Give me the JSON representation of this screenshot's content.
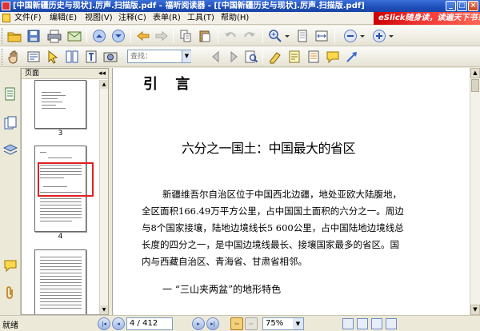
{
  "window": {
    "title": "[中国新疆历史与现状].厉声.扫描版.pdf - 福昕阅读器 - [[中国新疆历史与现状].厉声.扫描版.pdf]",
    "minimize": "_",
    "maximize": "□",
    "close": "×"
  },
  "menu": {
    "items": [
      {
        "label": "文件(F)"
      },
      {
        "label": "编辑(E)"
      },
      {
        "label": "视图(V)"
      },
      {
        "label": "注释(C)"
      },
      {
        "label": "表单(R)"
      },
      {
        "label": "工具(T)"
      },
      {
        "label": "帮助(H)"
      }
    ],
    "banner": "eSlick随身读，读遍天下书！"
  },
  "toolbar": {
    "find_placeholder": "查找：",
    "find_dropdown": "▼"
  },
  "pages_panel": {
    "title": "页面",
    "collapse": "◂◂",
    "thumbnails": [
      {
        "label": "3"
      },
      {
        "label": "4"
      }
    ]
  },
  "document": {
    "heading": "引 言",
    "subtitle": "六分之一国土：中国最大的省区",
    "paragraph_lines": [
      "新疆维吾尔自治区位于中国西北边疆，地处亚欧大陆腹地，",
      "全区面积166.49万平方公里，占中国国土面积的六分之一。周边",
      "与8个国家接壤，陆地边境线长5 600公里，占中国陆地边境线总",
      "长度的四分之一，是中国边境线最长、接壤国家最多的省区。国",
      "内与西藏自治区、青海省、甘肃省相邻。"
    ],
    "section": "一  “三山夹两盆”的地形特色"
  },
  "status": {
    "text": "就绪",
    "page_display": "4 / 412",
    "zoom": "75%",
    "zoom_dropdown": "▼",
    "first": "|◂",
    "prev": "◂",
    "next": "▸",
    "last": "▸|",
    "back": "⇦",
    "forward": "⇨"
  },
  "colors": {
    "title_bar": "#2857c8",
    "banner": "#d61f1f",
    "thumbnail_selection": "#e02020"
  }
}
